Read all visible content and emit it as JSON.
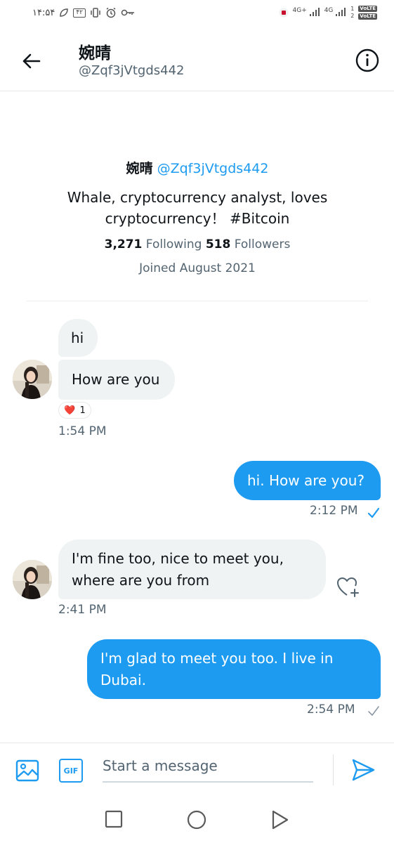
{
  "status_bar": {
    "time": "۱۴:۵۴",
    "battery": "۴۲",
    "network_1": "4G+",
    "network_2": "4G",
    "volte_1": "VoLTE",
    "volte_2": "VoLTE",
    "sim_1": "1",
    "sim_2": "2"
  },
  "header": {
    "name": "婉晴",
    "handle": "@Zqf3jVtgds442"
  },
  "profile": {
    "name": "婉晴",
    "handle": "@Zqf3jVtgds442",
    "bio": "Whale, cryptocurrency analyst, loves cryptocurrency！ #Bitcoin",
    "following_count": "3,271",
    "following_label": "Following",
    "followers_count": "518",
    "followers_label": "Followers",
    "joined": "Joined August 2021"
  },
  "messages": [
    {
      "direction": "incoming",
      "text": "hi"
    },
    {
      "direction": "incoming",
      "text": "How are you",
      "reaction_emoji": "❤️",
      "reaction_count": "1",
      "time": "1:54 PM"
    },
    {
      "direction": "outgoing",
      "text": "hi. How are you?",
      "time": "2:12 PM",
      "status": "seen"
    },
    {
      "direction": "incoming",
      "text": "I'm fine too, nice to meet you, where are you from",
      "time": "2:41 PM"
    },
    {
      "direction": "outgoing",
      "text": "I'm glad to meet you too. I live in Dubai.",
      "time": "2:54 PM",
      "status": "sent"
    }
  ],
  "composer": {
    "placeholder": "Start a message",
    "gif_label": "GIF"
  },
  "colors": {
    "accent": "#1d9bf0",
    "bubble_in": "#eff3f4",
    "text_secondary": "#536471"
  }
}
